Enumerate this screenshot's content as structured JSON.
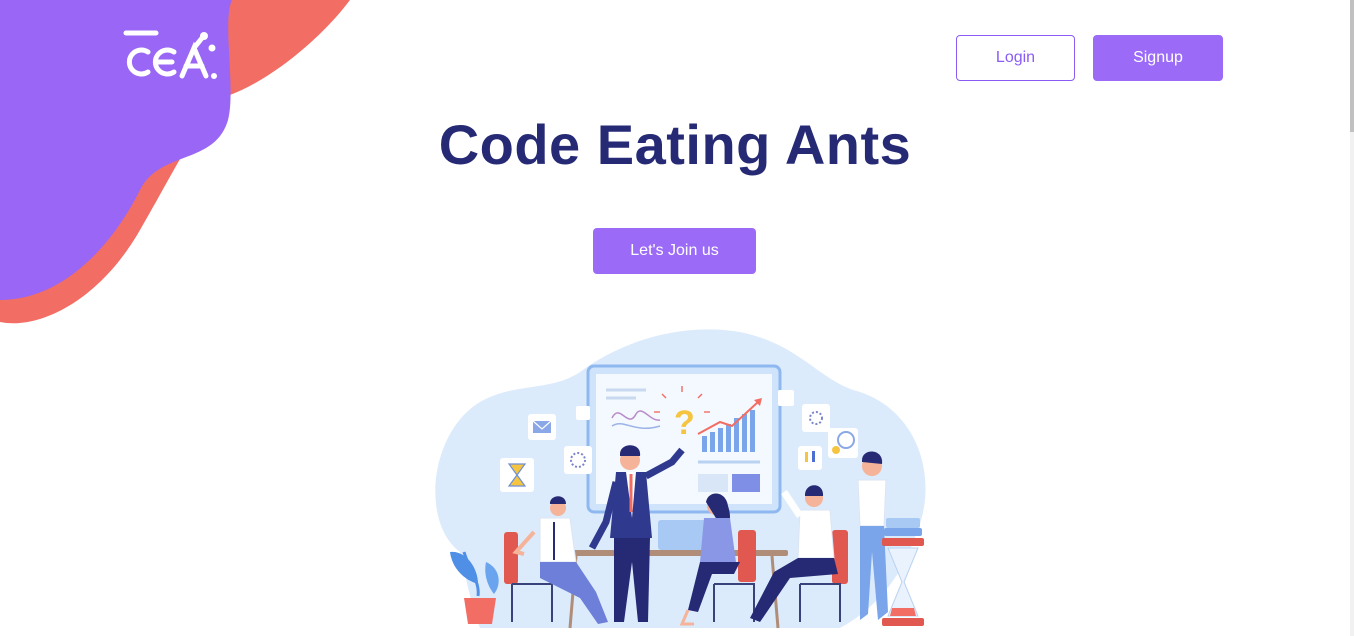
{
  "header": {
    "logo_alt": "CEA.",
    "login_label": "Login",
    "signup_label": "Signup"
  },
  "hero": {
    "title": "Code Eating Ants",
    "cta_label": "Let's Join us"
  },
  "colors": {
    "accent": "#9b6bf7",
    "coral": "#f26d64",
    "title": "#262a75",
    "illustration_bg": "#dcebfb"
  },
  "icons": [
    "logo-icon",
    "hourglass-icon",
    "envelope-icon",
    "loading-icon",
    "question-icon",
    "gear-icon",
    "exclamation-icon"
  ]
}
